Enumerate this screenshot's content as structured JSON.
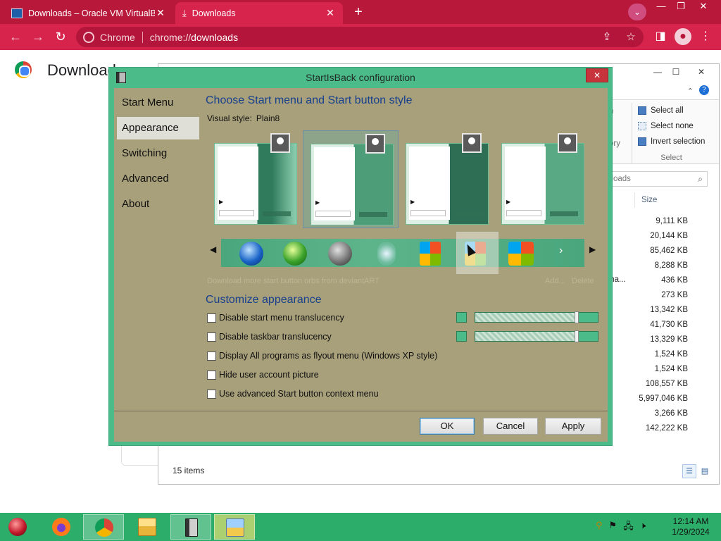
{
  "chrome": {
    "tabs": [
      {
        "title": "Downloads – Oracle VM VirtualB",
        "close": "✕"
      },
      {
        "title": "Downloads",
        "close": "✕"
      }
    ],
    "new_tab": "+",
    "omnibox": {
      "chip": "Chrome",
      "url_prefix": "chrome://",
      "url_host": "downloads"
    },
    "window_controls": {
      "minimize": "—",
      "maximize": "❐",
      "close": "✕"
    },
    "accent": "#d6244d"
  },
  "page": {
    "title": "Downloads"
  },
  "explorer": {
    "window_controls": {
      "minimize": "—",
      "maximize": "☐",
      "close": "✕"
    },
    "ribbon": {
      "select_all": "Select all",
      "select_none": "Select none",
      "invert_selection": "Invert selection",
      "group_caption": "Select",
      "frag_top": "n",
      "frag_mid": "ory"
    },
    "search_placeholder": "nloads",
    "size_header": "Size",
    "sizes": [
      "9,111 KB",
      "20,144 KB",
      "85,462 KB",
      "8,288 KB",
      "436 KB",
      "273 KB",
      "13,342 KB",
      "41,730 KB",
      "13,329 KB",
      "1,524 KB",
      "1,524 KB",
      "108,557 KB",
      "5,997,046 KB",
      "3,266 KB",
      "142,222 KB"
    ],
    "truncated_name": "ma...",
    "status": "15 items"
  },
  "dialog": {
    "title": "StartIsBack configuration",
    "close": "✕",
    "nav": [
      "Start Menu",
      "Appearance",
      "Switching",
      "Advanced",
      "About"
    ],
    "active_nav": "Appearance",
    "style_heading": "Choose Start menu and Start button style",
    "visual_style_label": "Visual style:",
    "visual_style_value": "Plain8",
    "selected_style_index": 1,
    "more_orbs_link": "Download more start button orbs from deviantART",
    "orb_add": "Add...",
    "orb_delete": "Delete",
    "customize_heading": "Customize appearance",
    "options": [
      {
        "label": "Disable start menu translucency",
        "checked": false,
        "slider": 0.83
      },
      {
        "label": "Disable taskbar translucency",
        "checked": false,
        "slider": 0.83
      },
      {
        "label": "Display All programs as flyout menu (Windows XP style)",
        "checked": false
      },
      {
        "label": "Hide user account picture",
        "checked": false
      },
      {
        "label": "Use advanced Start button context menu",
        "checked": false
      }
    ],
    "buttons": {
      "ok": "OK",
      "cancel": "Cancel",
      "apply": "Apply"
    },
    "colors": {
      "frame": "#4cbb8a",
      "body": "#a8a07a",
      "heading": "#17408e"
    }
  },
  "taskbar": {
    "items": [
      "start-orb",
      "firefox",
      "chrome",
      "file-explorer",
      "startisback",
      "control-panel"
    ],
    "clock_time": "12:14 AM",
    "clock_date": "1/29/2024",
    "color": "#2cae6a"
  }
}
